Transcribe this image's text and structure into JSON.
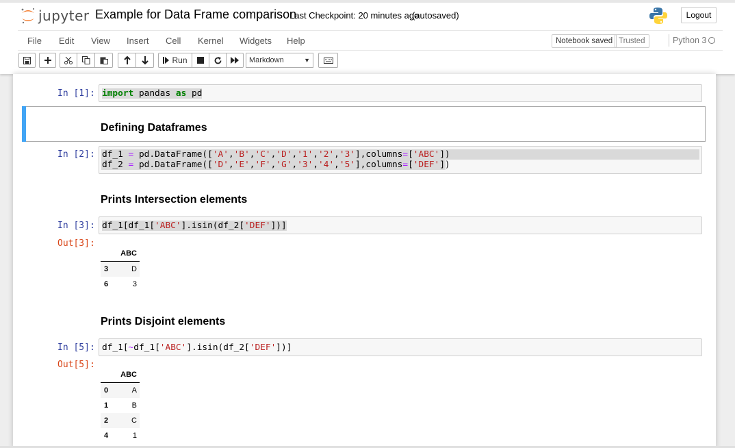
{
  "header": {
    "logo_text": "jupyter",
    "notebook_title": "Example for Data Frame comparison",
    "checkpoint": "Last Checkpoint: 20 minutes ago",
    "autosave": "(autosaved)",
    "logout": "Logout"
  },
  "menu": [
    "File",
    "Edit",
    "View",
    "Insert",
    "Cell",
    "Kernel",
    "Widgets",
    "Help"
  ],
  "status": {
    "notebook_saved": "Notebook saved",
    "trusted": "Trusted",
    "kernel": "Python 3"
  },
  "toolbar": {
    "run_label": "Run",
    "cell_type": "Markdown",
    "icons": [
      "save-icon",
      "plus-icon",
      "cut-icon",
      "copy-icon",
      "paste-icon",
      "arrow-up-icon",
      "arrow-down-icon",
      "run-icon",
      "stop-icon",
      "restart-icon",
      "fast-forward-icon",
      "keyboard-icon"
    ]
  },
  "cells": {
    "c1": {
      "prompt": "In [1]:"
    },
    "md1": {
      "heading": "Defining Dataframes"
    },
    "c2": {
      "prompt": "In [2]:"
    },
    "md2": {
      "heading": "Prints Intersection elements"
    },
    "c3": {
      "prompt": "In [3]:",
      "out_prompt": "Out[3]:"
    },
    "md3": {
      "heading": "Prints Disjoint elements"
    },
    "c5": {
      "prompt": "In [5]:",
      "out_prompt": "Out[5]:"
    }
  },
  "code": {
    "c1_import": "import",
    "c1_pandas": " pandas ",
    "c1_as": "as",
    "c1_pd": " pd",
    "c2_l1": "df_1 ",
    "c2_l1_eq": "=",
    "c2_l1_call": " pd.DataFrame([",
    "c2_l1_a": "'A'",
    "c2_l1_b": "'B'",
    "c2_l1_c": "'C'",
    "c2_l1_d": "'D'",
    "c2_l1_1": "'1'",
    "c2_l1_2": "'2'",
    "c2_l1_3": "'3'",
    "c2_l1_cols": "],columns",
    "c2_l1_eq2": "=",
    "c2_l1_colname": "'ABC'",
    "c2_l2": "df_2 ",
    "c2_l2_eq": "=",
    "c2_l2_call": " pd.DataFrame([",
    "c2_l2_d": "'D'",
    "c2_l2_e": "'E'",
    "c2_l2_f": "'F'",
    "c2_l2_g": "'G'",
    "c2_l2_3": "'3'",
    "c2_l2_4": "'4'",
    "c2_l2_5": "'5'",
    "c2_l2_cols": "],columns",
    "c2_l2_eq2": "=",
    "c2_l2_colname": "'DEF'",
    "c3_a": "df_1[df_1[",
    "c3_abc": "'ABC'",
    "c3_b": "].isin(df_2[",
    "c3_def": "'DEF'",
    "c3_c": "])]",
    "c5_a": "df_1[",
    "c5_tilde": "~",
    "c5_b": "df_1[",
    "c5_abc": "'ABC'",
    "c5_c": "].isin(df_2[",
    "c5_def": "'DEF'",
    "c5_d": "])]"
  },
  "out3": {
    "column": "ABC",
    "rows": [
      {
        "index": "3",
        "value": "D"
      },
      {
        "index": "6",
        "value": "3"
      }
    ]
  },
  "out5": {
    "column": "ABC",
    "rows": [
      {
        "index": "0",
        "value": "A"
      },
      {
        "index": "1",
        "value": "B"
      },
      {
        "index": "2",
        "value": "C"
      },
      {
        "index": "4",
        "value": "1"
      }
    ]
  }
}
